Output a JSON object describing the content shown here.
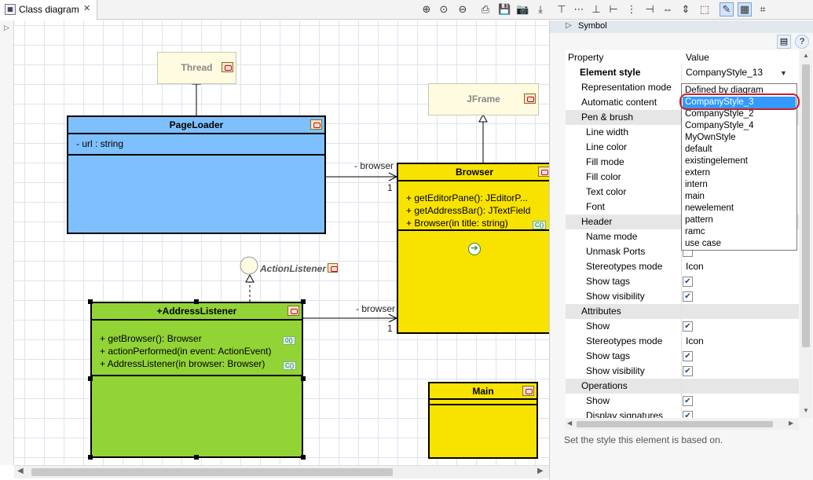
{
  "tab": {
    "title": "Class diagram"
  },
  "colors": {
    "blue_class": "#7ec0fe",
    "yellow_class": "#f8e200",
    "green_class": "#92d436",
    "ghost_class": "#fefbe0",
    "selection": "#3399ff",
    "highlight_ring": "#c8202a"
  },
  "toolbar": {
    "icons": [
      "zoom-in-icon",
      "zoom-reset-icon",
      "zoom-out-icon",
      "print-icon",
      "save-icon",
      "camera-icon",
      "export-icon",
      "align-top-icon",
      "align-middle-icon",
      "align-bottom-icon",
      "align-left-icon",
      "align-center-icon",
      "align-right-icon",
      "distribute-h-icon",
      "distribute-v-icon",
      "resize-icon",
      "format-painter-icon",
      "grid-icon",
      "snap-icon"
    ]
  },
  "diagram": {
    "thread": "Thread",
    "jframe": "JFrame",
    "pageloader": {
      "name": "PageLoader",
      "attr": "- url : string"
    },
    "browser": {
      "name": "Browser",
      "ops": [
        "+ getEditorPane(): JEditorP...",
        "+ getAddressBar(): JTextField",
        "+ Browser(in title: string)"
      ]
    },
    "actionlistener": "ActionListener",
    "addresslistener": {
      "name": "+AddressListener",
      "ops": [
        "+ getBrowser(): Browser",
        "+ actionPerformed(in event: ActionEvent)",
        "+ AddressListener(in browser: Browser)"
      ]
    },
    "main": "Main",
    "assoc1": {
      "role": "- browser",
      "mult": "1"
    },
    "assoc2": {
      "role": "- browser",
      "mult": "1"
    }
  },
  "panel": {
    "header": "Symbol",
    "col_property": "Property",
    "col_value": "Value",
    "description": "Set the style this element is based on.",
    "rows": [
      {
        "k": "Element style",
        "v": "CompanyStyle_13",
        "bold": true
      },
      {
        "k": "Representation mode",
        "v": ""
      },
      {
        "k": "Automatic content",
        "v": ""
      },
      {
        "k": "Pen & brush",
        "grp": true
      },
      {
        "k": "Line width",
        "v": ""
      },
      {
        "k": "Line color",
        "v": ""
      },
      {
        "k": "Fill mode",
        "v": ""
      },
      {
        "k": "Fill color",
        "v": ""
      },
      {
        "k": "Text color",
        "v": ""
      },
      {
        "k": "Font",
        "v": ""
      },
      {
        "k": "Header",
        "grp": true
      },
      {
        "k": "Name mode",
        "v": ""
      },
      {
        "k": "Unmask Ports",
        "cb": false
      },
      {
        "k": "Stereotypes mode",
        "v": "Icon"
      },
      {
        "k": "Show tags",
        "cb": true
      },
      {
        "k": "Show visibility",
        "cb": true
      },
      {
        "k": "Attributes",
        "grp": true
      },
      {
        "k": "Show",
        "cb": true
      },
      {
        "k": "Stereotypes mode",
        "v": "Icon"
      },
      {
        "k": "Show tags",
        "cb": true
      },
      {
        "k": "Show visibility",
        "cb": true
      },
      {
        "k": "Operations",
        "grp": true
      },
      {
        "k": "Show",
        "cb": true
      },
      {
        "k": "Display signatures",
        "cb": true
      }
    ],
    "dropdown": [
      "Defined by diagram",
      "CompanyStyle_3",
      "CompanyStyle_2",
      "CompanyStyle_4",
      "MyOwnStyle",
      "default",
      "existingelement",
      "extern",
      "intern",
      "main",
      "newelement",
      "pattern",
      "ramc",
      "use case"
    ],
    "dropdown_selected": 1
  }
}
